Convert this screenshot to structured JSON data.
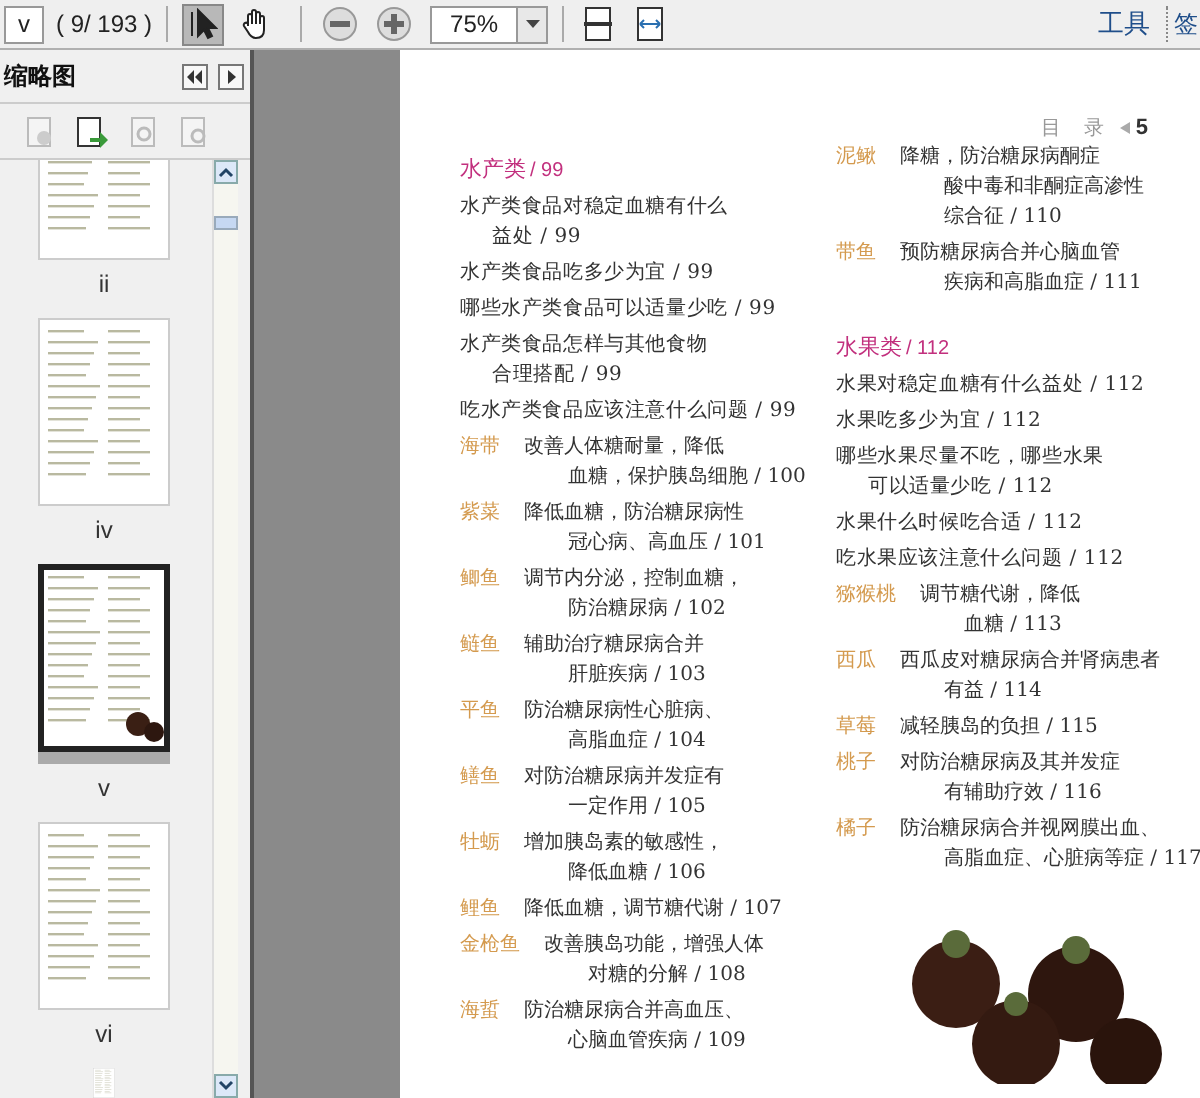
{
  "toolbar": {
    "page_field": "v",
    "page_count": "( 9/ 193 )",
    "tools": [
      {
        "kind": "select",
        "selected": true
      },
      {
        "kind": "hand",
        "selected": false
      }
    ],
    "zoom": "75%",
    "tools_label": "工具",
    "cut_label": "签"
  },
  "sidebar": {
    "title": "缩略图",
    "thumbnails": [
      {
        "label": "ii",
        "selected": false
      },
      {
        "label": "iv",
        "selected": false
      },
      {
        "label": "v",
        "selected": true
      },
      {
        "label": "vi",
        "selected": false
      }
    ]
  },
  "page": {
    "header": "目 录",
    "page_number": "5",
    "columns": [
      [
        {
          "kind": "heading",
          "title": "水产类",
          "page": "/ 99"
        },
        {
          "kind": "question",
          "lines": [
            "水产类食品对稳定血糖有什么",
            "益处 / 99"
          ]
        },
        {
          "kind": "question",
          "lines": [
            "水产类食品吃多少为宜 / 99"
          ]
        },
        {
          "kind": "question",
          "lines": [
            "哪些水产类食品可以适量少吃 / 99"
          ]
        },
        {
          "kind": "question",
          "lines": [
            "水产类食品怎样与其他食物",
            "合理搭配 / 99"
          ]
        },
        {
          "kind": "question",
          "lines": [
            "吃水产类食品应该注意什么问题 / 99"
          ]
        },
        {
          "kind": "food",
          "name": "海带",
          "lines": [
            "改善人体糖耐量，降低",
            "血糖，保护胰岛细胞 / 100"
          ]
        },
        {
          "kind": "food",
          "name": "紫菜",
          "lines": [
            "降低血糖，防治糖尿病性",
            "冠心病、高血压 / 101"
          ]
        },
        {
          "kind": "food",
          "name": "鲫鱼",
          "lines": [
            "调节内分泌，控制血糖，",
            "防治糖尿病 / 102"
          ]
        },
        {
          "kind": "food",
          "name": "鲢鱼",
          "lines": [
            "辅助治疗糖尿病合并",
            "肝脏疾病 / 103"
          ]
        },
        {
          "kind": "food",
          "name": "平鱼",
          "lines": [
            "防治糖尿病性心脏病、",
            "高脂血症 / 104"
          ]
        },
        {
          "kind": "food",
          "name": "鳝鱼",
          "lines": [
            "对防治糖尿病并发症有",
            "一定作用 / 105"
          ]
        },
        {
          "kind": "food",
          "name": "牡蛎",
          "lines": [
            "增加胰岛素的敏感性，",
            "降低血糖 / 106"
          ]
        },
        {
          "kind": "food",
          "name": "鲤鱼",
          "lines": [
            "降低血糖，调节糖代谢 / 107"
          ]
        },
        {
          "kind": "food",
          "name": "金枪鱼",
          "lines": [
            "改善胰岛功能，增强人体",
            "对糖的分解 / 108"
          ]
        },
        {
          "kind": "food",
          "name": "海蜇",
          "lines": [
            "防治糖尿病合并高血压、",
            "心脑血管疾病 / 109"
          ]
        }
      ],
      [
        {
          "kind": "food",
          "name": "泥鳅",
          "lines": [
            "降糖，防治糖尿病酮症",
            "酸中毒和非酮症高渗性",
            "综合征 / 110"
          ]
        },
        {
          "kind": "food",
          "name": "带鱼",
          "lines": [
            "预防糖尿病合并心脑血管",
            "疾病和高脂血症 / 111"
          ]
        },
        {
          "kind": "heading",
          "title": "水果类",
          "page": "/ 112"
        },
        {
          "kind": "question",
          "lines": [
            "水果对稳定血糖有什么益处 / 112"
          ]
        },
        {
          "kind": "question",
          "lines": [
            "水果吃多少为宜 / 112"
          ]
        },
        {
          "kind": "question",
          "lines": [
            "哪些水果尽量不吃，哪些水果",
            "可以适量少吃 / 112"
          ]
        },
        {
          "kind": "question",
          "lines": [
            "水果什么时候吃合适 / 112"
          ]
        },
        {
          "kind": "question",
          "lines": [
            "吃水果应该注意什么问题 / 112"
          ]
        },
        {
          "kind": "food",
          "name": "猕猴桃",
          "lines": [
            "调节糖代谢，降低",
            "血糖 / 113"
          ]
        },
        {
          "kind": "food",
          "name": "西瓜",
          "lines": [
            "西瓜皮对糖尿病合并肾病患者",
            "有益 / 114"
          ]
        },
        {
          "kind": "food",
          "name": "草莓",
          "lines": [
            "减轻胰岛的负担 / 115"
          ]
        },
        {
          "kind": "food",
          "name": "桃子",
          "lines": [
            "对防治糖尿病及其并发症",
            "有辅助疗效 / 116"
          ]
        },
        {
          "kind": "food",
          "name": "橘子",
          "lines": [
            "防治糖尿病合并视网膜出血、",
            "高脂血症、心脏病等症 / 117"
          ]
        }
      ]
    ]
  }
}
